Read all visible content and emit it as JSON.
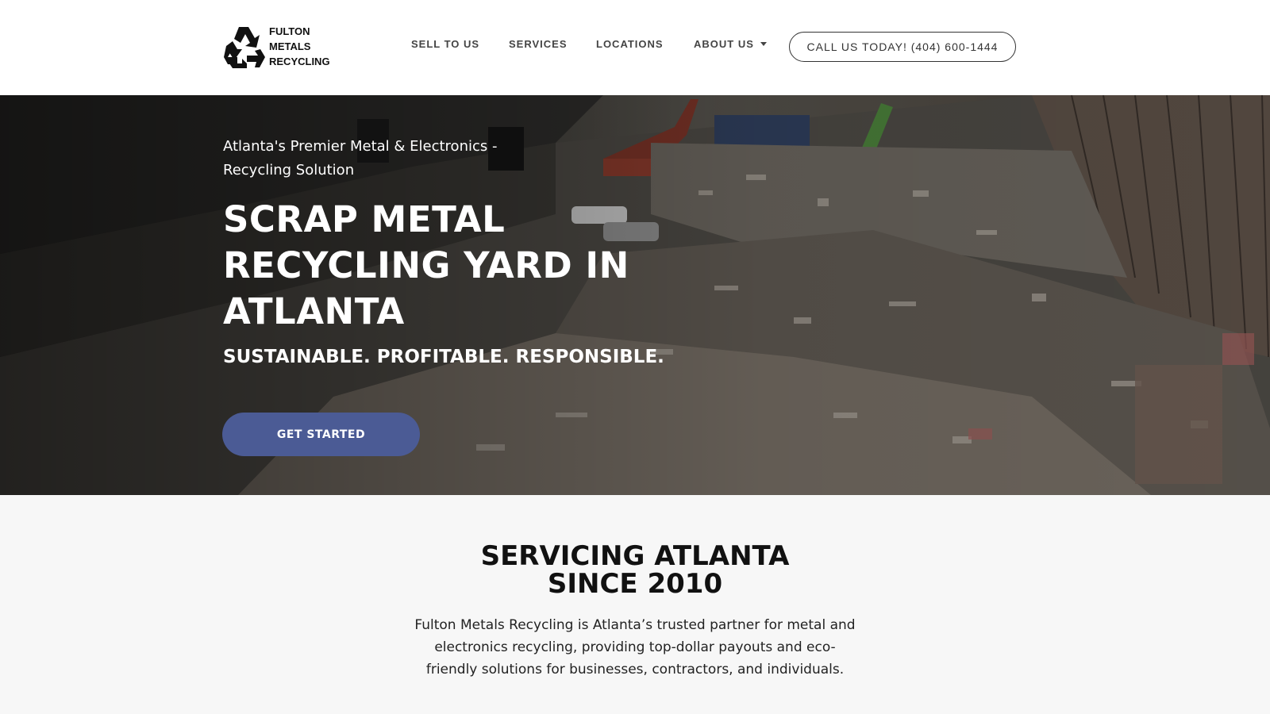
{
  "brand": {
    "logo_lines": [
      "FULTON",
      "METALS",
      "RECYCLING"
    ],
    "logo_icon": "recycle-icon"
  },
  "nav": {
    "items": [
      {
        "label": "SELL TO US"
      },
      {
        "label": "SERVICES"
      },
      {
        "label": "LOCATIONS"
      },
      {
        "label": "ABOUT US",
        "icon": "chevron-down-icon"
      }
    ],
    "call_label": "CALL US TODAY! (404) 600-1444"
  },
  "hero": {
    "kicker": "Atlanta's Premier Metal & Electronics - Recycling Solution",
    "title": "SCRAP METAL RECYCLING YARD IN ATLANTA",
    "tagline": "SUSTAINABLE. PROFITABLE. RESPONSIBLE.",
    "cta_label": "GET STARTED",
    "cta_color": "#4b5b95"
  },
  "intro": {
    "title_lines": [
      "SERVICING ATLANTA",
      "SINCE 2010"
    ],
    "text": "Fulton Metals Recycling is Atlanta’s trusted partner for metal and electronics recycling, providing top-dollar payouts and eco-friendly solutions for businesses, contractors, and individuals."
  }
}
